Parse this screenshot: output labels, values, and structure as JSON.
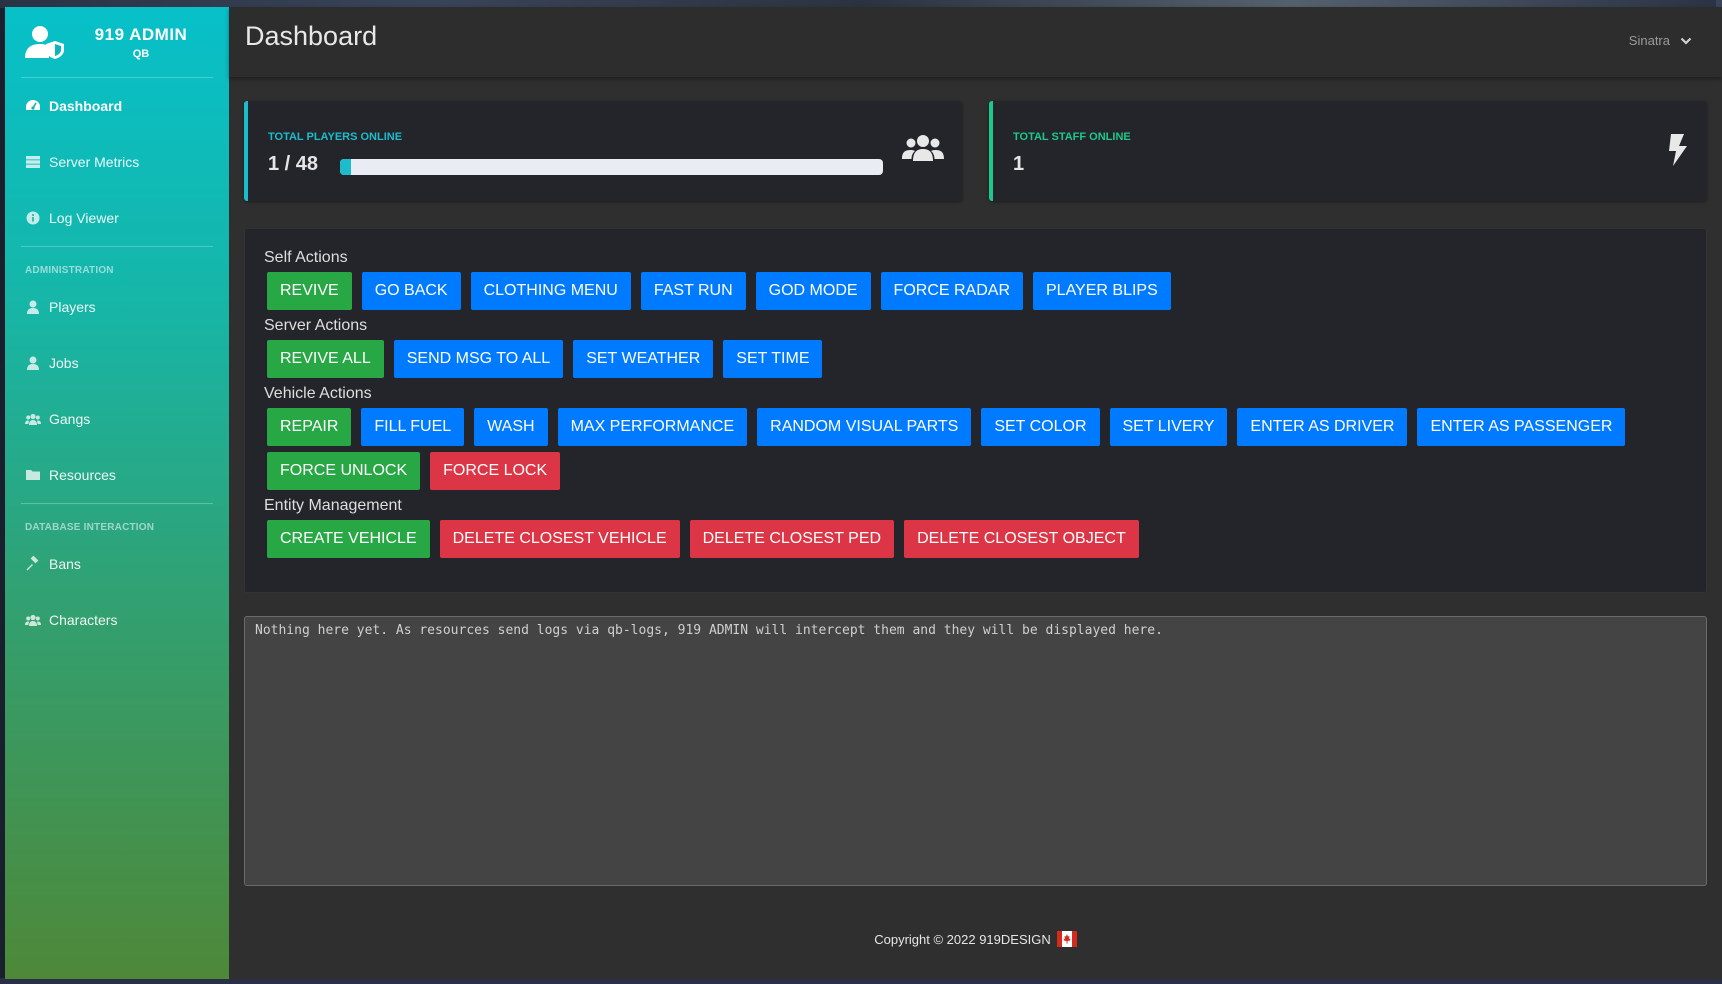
{
  "brand": {
    "title": "919 ADMIN",
    "subtitle": "QB"
  },
  "sidebar": {
    "items": [
      {
        "label": "Dashboard"
      },
      {
        "label": "Server Metrics"
      },
      {
        "label": "Log Viewer"
      }
    ],
    "administration_heading": "ADMINISTRATION",
    "admin_items": [
      {
        "label": "Players"
      },
      {
        "label": "Jobs"
      },
      {
        "label": "Gangs"
      },
      {
        "label": "Resources"
      }
    ],
    "database_heading": "DATABASE INTERACTION",
    "db_items": [
      {
        "label": "Bans"
      },
      {
        "label": "Characters"
      }
    ]
  },
  "header": {
    "title": "Dashboard",
    "user": "Sinatra"
  },
  "stats": {
    "players": {
      "label": "TOTAL PLAYERS ONLINE",
      "value": "1 / 48",
      "fraction": 0.02
    },
    "staff": {
      "label": "TOTAL STAFF ONLINE",
      "value": "1"
    }
  },
  "sections": {
    "self": {
      "title": "Self Actions",
      "buttons": [
        "REVIVE",
        "GO BACK",
        "CLOTHING MENU",
        "FAST RUN",
        "GOD MODE",
        "FORCE RADAR",
        "PLAYER BLIPS"
      ]
    },
    "server": {
      "title": "Server Actions",
      "buttons": [
        "REVIVE ALL",
        "SEND MSG TO ALL",
        "SET WEATHER",
        "SET TIME"
      ]
    },
    "vehicle": {
      "title": "Vehicle Actions",
      "buttons": [
        "REPAIR",
        "FILL FUEL",
        "WASH",
        "MAX PERFORMANCE",
        "RANDOM VISUAL PARTS",
        "SET COLOR",
        "SET LIVERY",
        "ENTER AS DRIVER",
        "ENTER AS PASSENGER",
        "FORCE UNLOCK",
        "FORCE LOCK"
      ]
    },
    "entity": {
      "title": "Entity Management",
      "buttons": [
        "CREATE VEHICLE",
        "DELETE CLOSEST VEHICLE",
        "DELETE CLOSEST PED",
        "DELETE CLOSEST OBJECT"
      ]
    }
  },
  "logs": {
    "text": "Nothing here yet. As resources send logs via qb-logs, 919 ADMIN will intercept them and they will be displayed here."
  },
  "footer": {
    "copyright": "Copyright © 2022 919DESIGN"
  },
  "colors": {
    "green": "#28a745",
    "blue": "#007bff",
    "red": "#dc3545",
    "info": "#1cbccc",
    "success": "#1cc88a"
  }
}
